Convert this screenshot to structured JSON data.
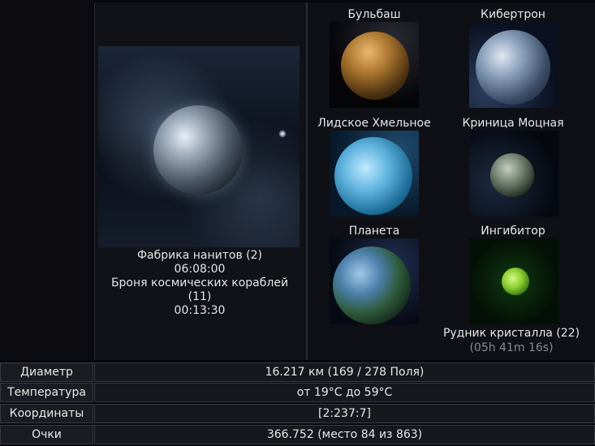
{
  "current_planet": {
    "build_queue": [
      {
        "name": "Фабрика нанитов (2)",
        "time": "06:08:00"
      },
      {
        "name_line1": "Броня космических кораблей",
        "name_line2": "(11)",
        "time": "00:13:30"
      }
    ]
  },
  "planets": [
    {
      "name": "Бульбаш"
    },
    {
      "name": "Кибертрон"
    },
    {
      "name": "Лидское Хмельное"
    },
    {
      "name": "Криница Моцная"
    },
    {
      "name": "Планета"
    },
    {
      "name": "Ингибитор",
      "build_name": "Рудник кристалла (22)",
      "build_time": "(05h 41m 16s)"
    }
  ],
  "info": {
    "diameter_label": "Диаметр",
    "diameter_value": "16.217 км (169 / 278 Поля)",
    "temperature_label": "Температура",
    "temperature_value": "от 19°C до 59°C",
    "coordinates_label": "Координаты",
    "coordinates_value": "[2:237:7]",
    "points_label": "Очки",
    "points_value": "366.752 (место 84 из 863)"
  }
}
